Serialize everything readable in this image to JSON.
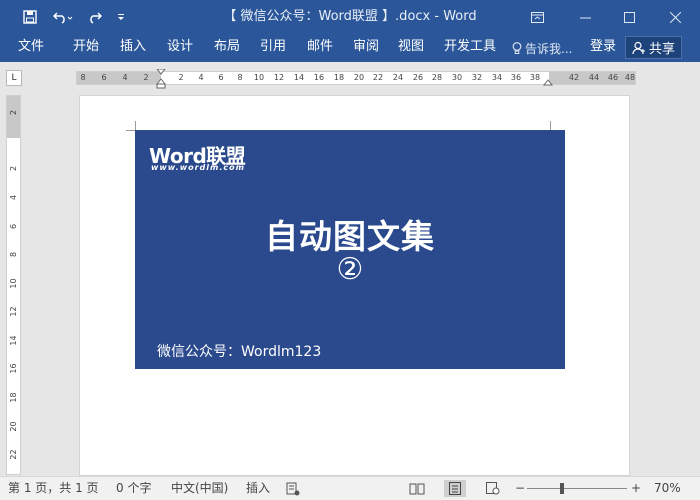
{
  "window": {
    "title": "【 微信公众号：Word联盟 】.docx - Word",
    "quick_access": {
      "save_icon": "save-icon",
      "undo_icon": "undo-icon",
      "redo_icon": "redo-icon",
      "customize_icon": "customize-icon"
    },
    "controls": {
      "ribbon_options_icon": "ribbon-display-icon",
      "minimize_icon": "minimize-icon",
      "maximize_icon": "maximize-icon",
      "close_icon": "close-icon"
    }
  },
  "menu": {
    "items": [
      "文件",
      "开始",
      "插入",
      "设计",
      "布局",
      "引用",
      "邮件",
      "审阅",
      "视图",
      "开发工具"
    ],
    "tell_me": "告诉我...",
    "login": "登录",
    "share": "共享"
  },
  "ruler": {
    "corner_label": "L",
    "horizontal_ticks": [
      "8",
      "6",
      "4",
      "2",
      "2",
      "4",
      "6",
      "8",
      "10",
      "12",
      "14",
      "16",
      "18",
      "20",
      "22",
      "24",
      "26",
      "28",
      "30",
      "32",
      "34",
      "36",
      "38",
      "42",
      "44",
      "46",
      "48"
    ],
    "vertical_ticks": [
      "2",
      "2",
      "4",
      "6",
      "8",
      "10",
      "12",
      "14",
      "16",
      "18",
      "20",
      "22"
    ]
  },
  "document": {
    "banner": {
      "brand": "Word联盟",
      "brand_url": "www.wordlm.com",
      "title": "自动图文集",
      "number": "②",
      "footer": "微信公众号：Wordlm123"
    }
  },
  "status": {
    "page": "第 1 页，共 1 页",
    "words": "0 个字",
    "language": "中文(中国)",
    "mode": "插入",
    "zoom_minus": "−",
    "zoom_plus": "+",
    "zoom": "70%"
  },
  "colors": {
    "accent": "#2b579a",
    "banner": "#2a4a8d"
  }
}
